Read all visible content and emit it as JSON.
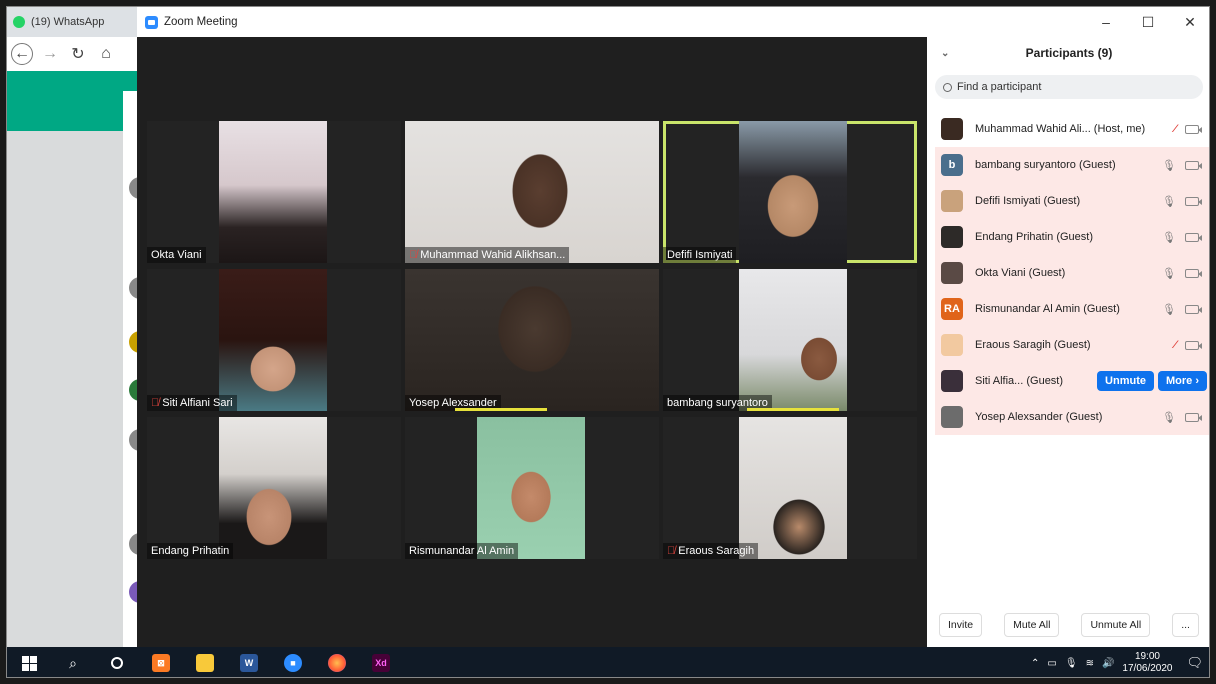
{
  "background_window": {
    "tab_title": "(19) WhatsApp"
  },
  "zoom": {
    "title": "Zoom Meeting",
    "window_controls": [
      "–",
      "☐",
      "✕"
    ]
  },
  "video_tiles": [
    {
      "name": "Okta Viani",
      "muted": false
    },
    {
      "name": "Muhammad Wahid Alikhsan...",
      "muted": true
    },
    {
      "name": "Defifi Ismiyati",
      "muted": false,
      "active": true
    },
    {
      "name": "Siti Alfiani Sari",
      "muted": true
    },
    {
      "name": "Yosep Alexsander",
      "muted": false
    },
    {
      "name": "bambang suryantoro",
      "muted": false
    },
    {
      "name": "Endang Prihatin",
      "muted": false
    },
    {
      "name": "Rismunandar Al Amin",
      "muted": false
    },
    {
      "name": "Eraous Saragih",
      "muted": true
    }
  ],
  "participants_panel": {
    "title": "Participants (9)",
    "search_placeholder": "Find a participant",
    "participants": [
      {
        "name": "Muhammad Wahid Ali...  (Host, me)",
        "avatar": "photo",
        "avatar_color": "#3a2a22",
        "muted": true
      },
      {
        "name": "bambang suryantoro (Guest)",
        "avatar": "b",
        "avatar_color": "#4a6e8c",
        "muted": false
      },
      {
        "name": "Defifi Ismiyati (Guest)",
        "avatar": "photo",
        "avatar_color": "#c9a27c",
        "muted": false
      },
      {
        "name": "Endang Prihatin (Guest)",
        "avatar": "photo",
        "avatar_color": "#2d2a28",
        "muted": false
      },
      {
        "name": "Okta Viani (Guest)",
        "avatar": "photo",
        "avatar_color": "#5a4a45",
        "muted": false
      },
      {
        "name": "Rismunandar Al Amin (Guest)",
        "avatar": "RA",
        "avatar_color": "#e0641a",
        "muted": false
      },
      {
        "name": "Eraous Saragih (Guest)",
        "avatar": "photo",
        "avatar_color": "#f2c9a0",
        "muted": true
      },
      {
        "name": "Siti Alfia...  (Guest)",
        "avatar": "photo",
        "avatar_color": "#3a2f3a",
        "muted": true,
        "hover": true
      },
      {
        "name": "Yosep Alexsander (Guest)",
        "avatar": "photo",
        "avatar_color": "#6c6c6c",
        "muted": false
      }
    ],
    "unmute_label": "Unmute",
    "more_label": "More ›",
    "footer": {
      "invite": "Invite",
      "mute_all": "Mute All",
      "unmute_all": "Unmute All",
      "more": "..."
    }
  },
  "taskbar": {
    "time": "19:00",
    "date": "17/06/2020"
  }
}
